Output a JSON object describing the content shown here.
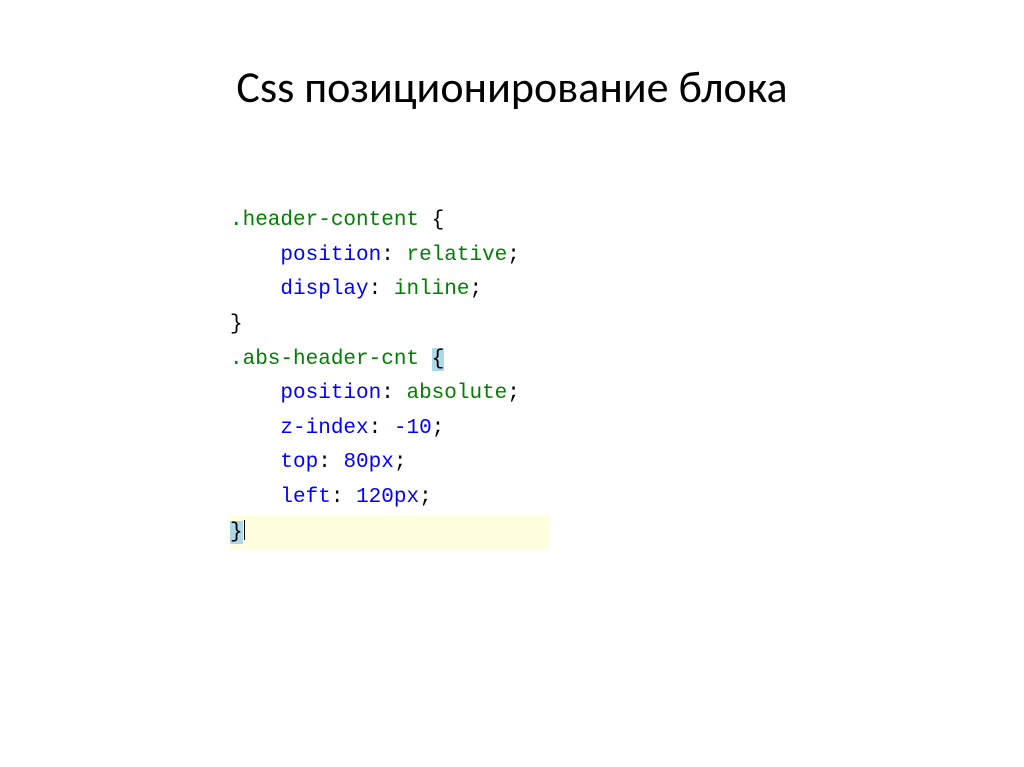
{
  "title": "Css позиционирование блока",
  "code": {
    "rule1": {
      "selector": ".header-content",
      "open": "{",
      "close": "}",
      "decl1": {
        "prop": "position",
        "val": "relative"
      },
      "decl2": {
        "prop": "display",
        "val": "inline"
      }
    },
    "rule2": {
      "selector": ".abs-header-cnt",
      "open": "{",
      "close": "}",
      "decl1": {
        "prop": "position",
        "val": "absolute"
      },
      "decl2": {
        "prop": "z-index",
        "val": "-10"
      },
      "decl3": {
        "prop": "top",
        "val": "80px"
      },
      "decl4": {
        "prop": "left",
        "val": "120px"
      }
    }
  }
}
